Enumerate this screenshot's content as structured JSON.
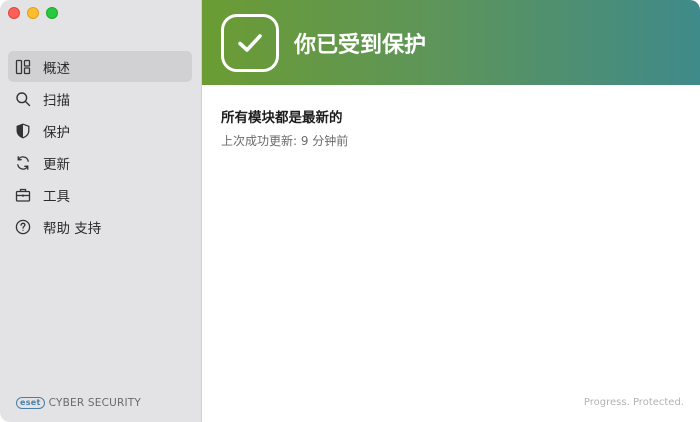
{
  "sidebar": {
    "items": [
      {
        "label": "概述",
        "icon": "overview-icon",
        "active": true
      },
      {
        "label": "扫描",
        "icon": "search-icon",
        "active": false
      },
      {
        "label": "保护",
        "icon": "shield-icon",
        "active": false
      },
      {
        "label": "更新",
        "icon": "refresh-icon",
        "active": false
      },
      {
        "label": "工具",
        "icon": "toolbox-icon",
        "active": false
      },
      {
        "label": "帮助 支持",
        "icon": "help-icon",
        "active": false
      }
    ],
    "brand": {
      "logo_text": "eset",
      "product": "CYBER SECURITY"
    }
  },
  "banner": {
    "title": "你已受到保护",
    "icon": "checkmark-icon",
    "colors": {
      "start": "#6b9c33",
      "end": "#3f8a8a"
    }
  },
  "status": {
    "title": "所有模块都是最新的",
    "subtitle": "上次成功更新: 9 分钟前"
  },
  "footer": {
    "tagline": "Progress. Protected."
  }
}
